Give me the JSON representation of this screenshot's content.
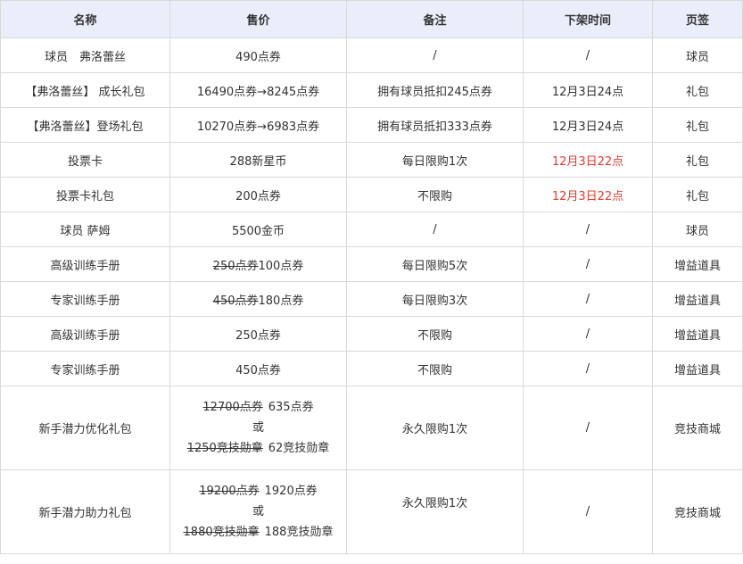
{
  "headers": [
    "名称",
    "售价",
    "备注",
    "下架时间",
    "页签"
  ],
  "rows": [
    {
      "name": "球员　弗洛蕾丝",
      "price": "490点券",
      "note": "/",
      "time": "/",
      "tab": "球员"
    },
    {
      "name": "【弗洛蕾丝】 成长礼包",
      "price": "16490点券→8245点券",
      "note": "拥有球员抵扣245点券",
      "time": "12月3日24点",
      "tab": "礼包"
    },
    {
      "name": "【弗洛蕾丝】登场礼包",
      "price": "10270点券→6983点券",
      "note": "拥有球员抵扣333点券",
      "time": "12月3日24点",
      "tab": "礼包"
    },
    {
      "name": "投票卡",
      "price": "288新星币",
      "note": "每日限购1次",
      "time": "12月3日22点",
      "tab": "礼包"
    },
    {
      "name": "投票卡礼包",
      "price": "200点券",
      "note": "不限购",
      "time": "12月3日22点",
      "tab": "礼包"
    },
    {
      "name": "球员 萨姆",
      "price": "5500金币",
      "note": "/",
      "time": "/",
      "tab": "球员"
    },
    {
      "name": "高级训练手册",
      "price_old": "250点券",
      "price_new": "100点券",
      "note": "每日限购5次",
      "time": "/",
      "tab": "增益道具"
    },
    {
      "name": "专家训练手册",
      "price_old": "450点券",
      "price_new": "180点券",
      "note": "每日限购3次",
      "time": "/",
      "tab": "增益道具"
    },
    {
      "name": "高级训练手册",
      "price": "250点券",
      "note": "不限购",
      "time": "/",
      "tab": "增益道具"
    },
    {
      "name": "专家训练手册",
      "price": "450点券",
      "note": "不限购",
      "time": "/",
      "tab": "增益道具"
    },
    {
      "name": "新手潜力优化礼包",
      "price_old_1": "12700点券",
      "price_new_1": "635点券",
      "or": "或",
      "price_old_2": "1250竞技勋章",
      "price_new_2": "62竞技勋章",
      "note": "永久限购1次",
      "time": "/",
      "tab": "竞技商城"
    },
    {
      "name": "新手潜力助力礼包",
      "price_old_1": "19200点券",
      "price_new_1": "1920点券",
      "or": "或",
      "price_old_2": "1880竞技勋章",
      "price_new_2": "188竞技勋章",
      "note": "永久限购1次",
      "time": "/",
      "tab": "竞技商城"
    }
  ],
  "colors": {
    "header_bg": "#e9eefa",
    "border": "#d9d9d9",
    "text": "#333333",
    "highlight_red": "#e23b2e"
  }
}
